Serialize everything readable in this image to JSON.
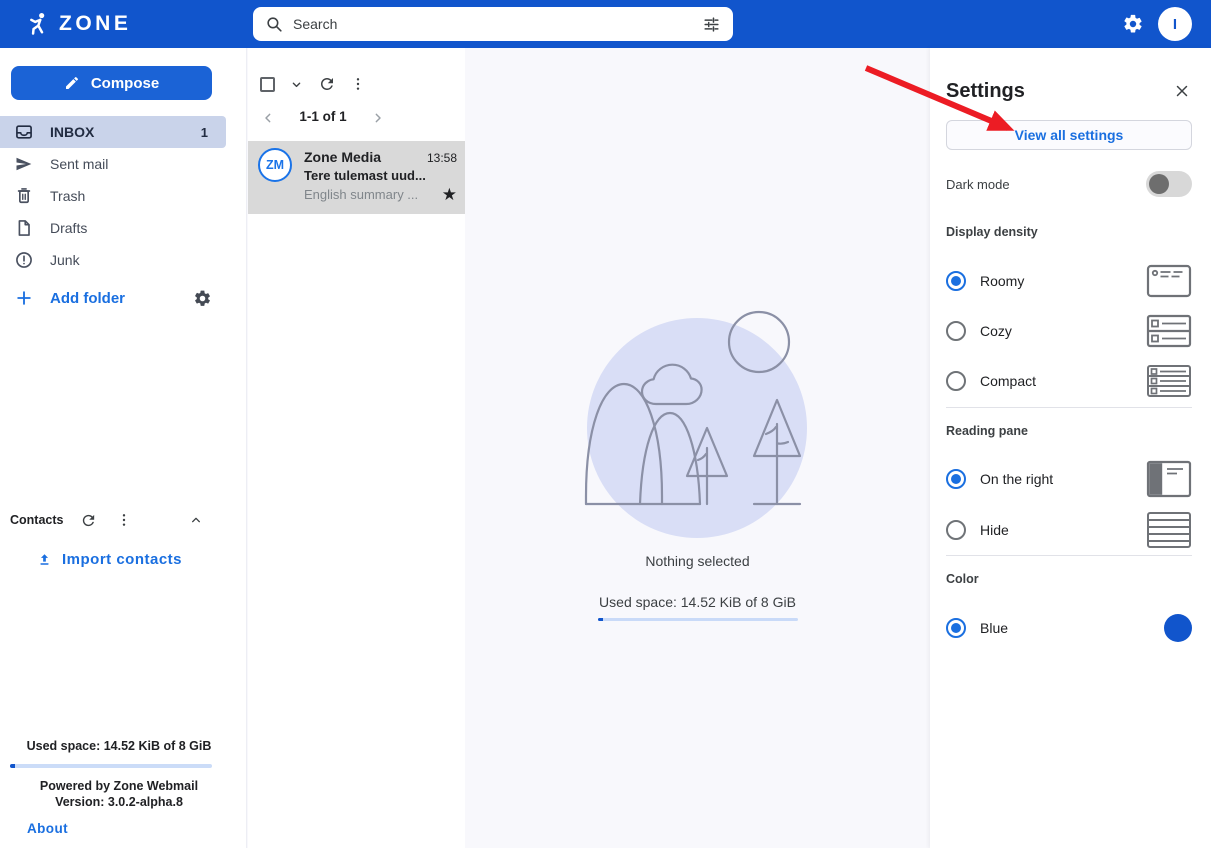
{
  "topbar": {
    "brand": "zone",
    "search_placeholder": "Search",
    "avatar_initial": "I"
  },
  "sidebar": {
    "compose_label": "Compose",
    "folders": [
      {
        "label": "INBOX",
        "count": "1"
      },
      {
        "label": "Sent mail"
      },
      {
        "label": "Trash"
      },
      {
        "label": "Drafts"
      },
      {
        "label": "Junk"
      }
    ],
    "add_folder_label": "Add folder",
    "contacts_label": "Contacts",
    "import_contacts_label": "Import contacts",
    "used_space": "Used space: 14.52 KiB of 8 GiB",
    "powered_by": "Powered by Zone Webmail",
    "version": "Version: 3.0.2-alpha.8",
    "about_label": "About"
  },
  "maillist": {
    "pagination": "1-1 of 1",
    "email": {
      "avatar_initials": "ZM",
      "sender": "Zone Media",
      "time": "13:58",
      "subject": "Tere tulemast uud...",
      "preview": "English summary ...",
      "star": "★"
    }
  },
  "main": {
    "nothing_selected": "Nothing selected",
    "used_space": "Used space: 14.52 KiB of 8 GiB"
  },
  "settings": {
    "title": "Settings",
    "view_all_label": "View all settings",
    "dark_mode_label": "Dark mode",
    "display_density": {
      "label": "Display density",
      "options": [
        "Roomy",
        "Cozy",
        "Compact"
      ],
      "selected": "Roomy"
    },
    "reading_pane": {
      "label": "Reading pane",
      "options": [
        "On the right",
        "Hide"
      ],
      "selected": "On the right"
    },
    "color": {
      "label": "Color",
      "options": [
        "Blue"
      ],
      "selected": "Blue",
      "swatch_hex": "#1155cc"
    }
  },
  "colors": {
    "topbar_blue": "#1155cc",
    "accent_blue": "#1a6fe0",
    "selected_folder_bg": "#c9d3ea",
    "selected_email_bg": "#d9d9d9",
    "illustration_bg": "#d9def6",
    "arrow_red": "#ec1c24"
  }
}
